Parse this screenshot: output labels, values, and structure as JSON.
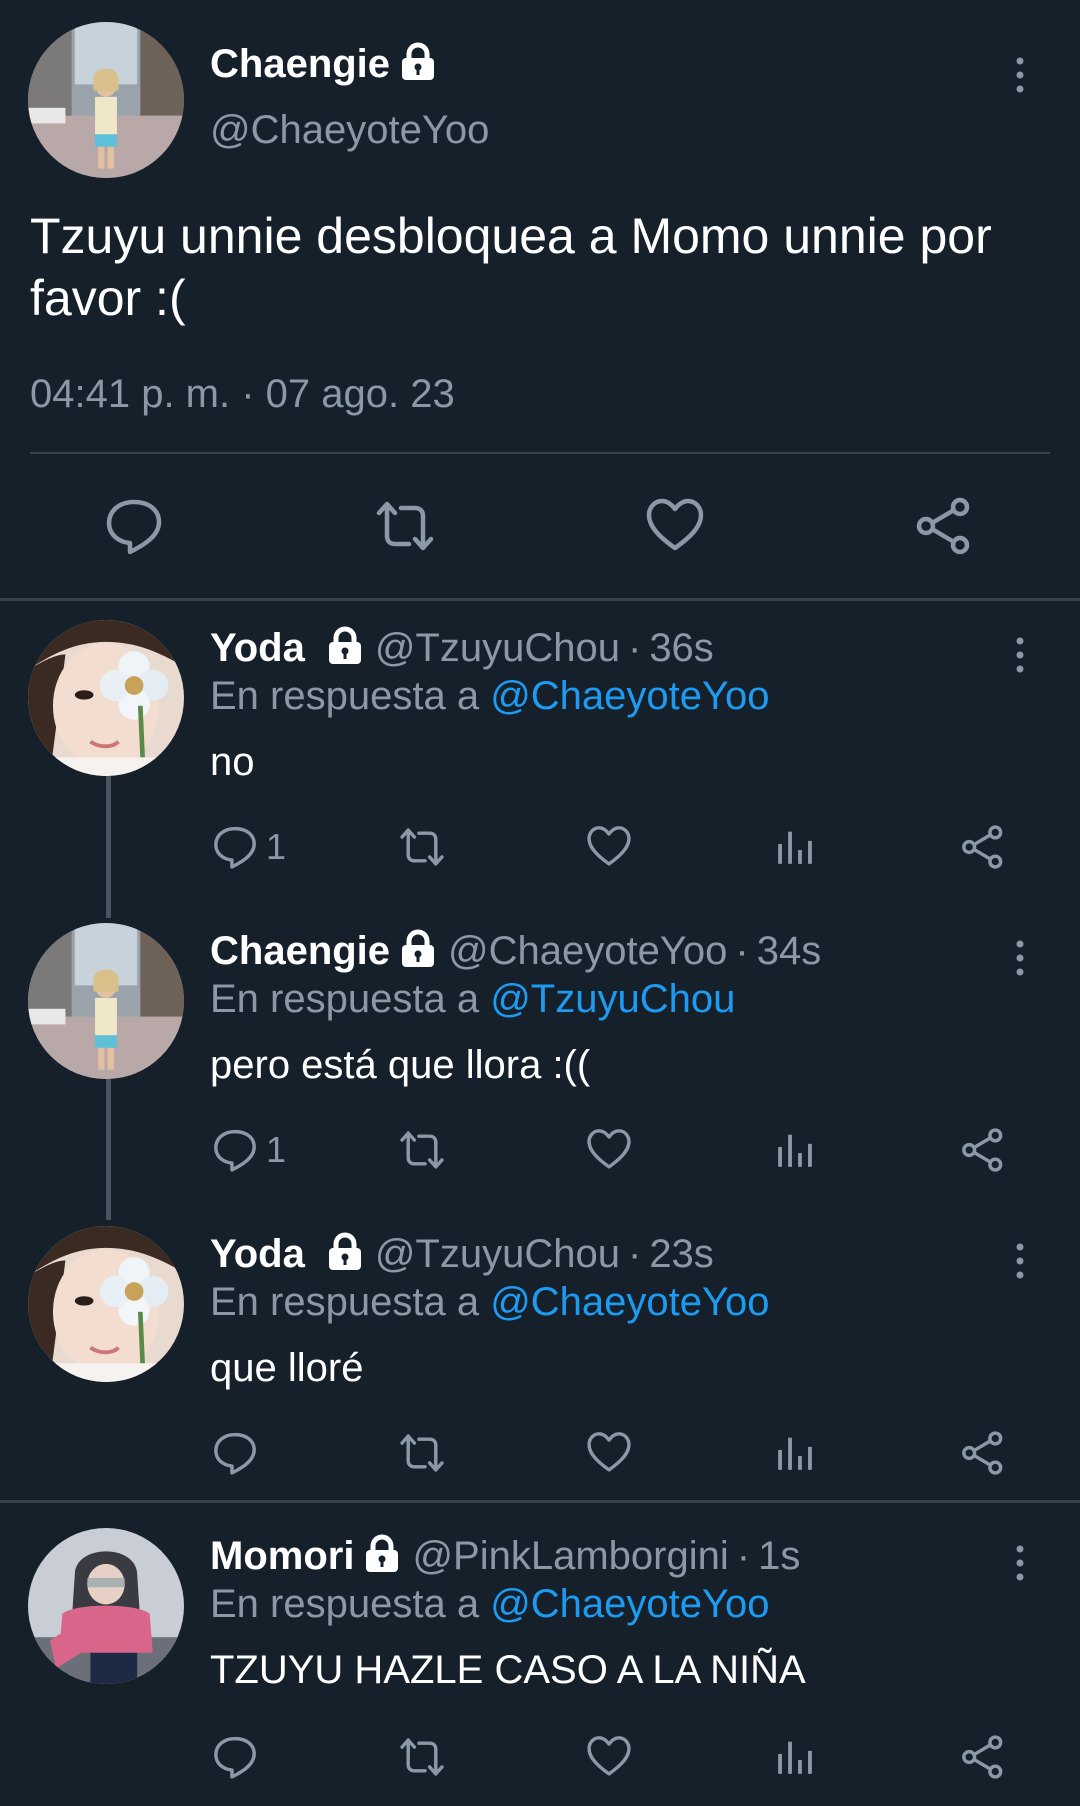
{
  "main_tweet": {
    "display_name": "Chaengie",
    "handle": "@ChaeyoteYoo",
    "text": "Tzuyu unnie desbloquea a Momo unnie por favor :(",
    "timestamp": "04:41 p. m. · 07 ago. 23",
    "icons": [
      "reply-icon",
      "retweet-icon",
      "like-icon",
      "share-icon",
      "lock-icon",
      "more-icon"
    ]
  },
  "replies": [
    {
      "display_name": "Yoda",
      "handle": "@TzuyuChou",
      "time": "36s",
      "reply_prefix": "En respuesta a",
      "reply_to": "@ChaeyoteYoo",
      "text": "no",
      "reply_count": "1"
    },
    {
      "display_name": "Chaengie",
      "handle": "@ChaeyoteYoo",
      "time": "34s",
      "reply_prefix": "En respuesta a",
      "reply_to": "@TzuyuChou",
      "text": "pero está que llora :((",
      "reply_count": "1"
    },
    {
      "display_name": "Yoda",
      "handle": "@TzuyuChou",
      "time": "23s",
      "reply_prefix": "En respuesta a",
      "reply_to": "@ChaeyoteYoo",
      "text": "que lloré",
      "reply_count": ""
    },
    {
      "display_name": "Momori",
      "handle": "@PinkLamborgini",
      "time": "1s",
      "reply_prefix": "En respuesta a",
      "reply_to": "@ChaeyoteYoo",
      "text": "TZUYU HAZLE CASO A LA NIÑA",
      "reply_count": ""
    }
  ],
  "separator": "·",
  "colors": {
    "background": "#15202b",
    "divider": "#38444d",
    "secondary_text": "#8b98a5",
    "mention": "#1d9bf0"
  }
}
